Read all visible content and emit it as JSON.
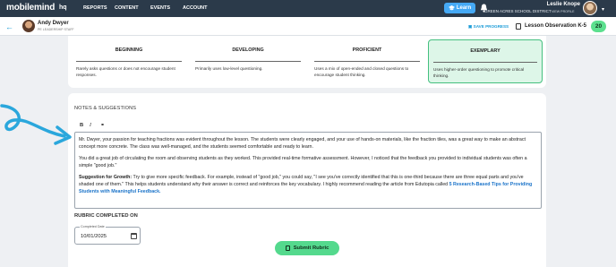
{
  "colors": {
    "nav_bg": "#2b3a4a",
    "accent_blue": "#45a9f5",
    "accent_green": "#54d98d",
    "selected_bg": "#ddf6e8",
    "arrow": "#2aa7dc"
  },
  "topnav": {
    "logo": "mobilemind",
    "logo_suffix": "hq",
    "items": [
      "REPORTS",
      "CONTENT",
      "EVENTS",
      "ACCOUNT"
    ],
    "learn_label": "Learn",
    "user_name": "Leslie Knope",
    "district": "GREEN ACRES SCHOOL DISTRICT",
    "view_profile": "VIEW PROFILE"
  },
  "subheader": {
    "staff_name": "Andy Dwyer",
    "staff_role": "PE LEADERSHIP STAFF",
    "save_progress": "SAVE PROGRESS",
    "observation_title": "Lesson Observation K-5",
    "score": "20"
  },
  "rubric": {
    "levels": [
      {
        "title": "BEGINNING",
        "desc": "Rarely asks questions or does not encourage student responses."
      },
      {
        "title": "DEVELOPING",
        "desc": "Primarily uses low-level questioning."
      },
      {
        "title": "PROFICIENT",
        "desc": "Uses a mix of open-ended and closed questions to encourage student thinking."
      },
      {
        "title": "EXEMPLARY",
        "desc": "Uses higher-order questioning to promote critical thinking."
      }
    ],
    "selected_index": 3
  },
  "notes": {
    "heading": "NOTES & SUGGESTIONS",
    "toolbar": {
      "bold": "B",
      "italic": "I",
      "link": "⚭"
    },
    "paragraph1": "Mr. Dwyer, your passion for teaching fractions was evident throughout the lesson. The students were clearly engaged, and your use of hands-on materials, like the fraction tiles, was a great way to make an abstract concept more concrete. The class was well-managed, and the students seemed comfortable and ready to learn.",
    "paragraph2": "You did a great job of circulating the room and observing students as they worked. This provided real-time formative assessment. However, I noticed that the feedback you provided to individual students was often a simple \"good job.\"",
    "paragraph3_label": "Suggestion for Growth:",
    "paragraph3_text": " Try to give more specific feedback. For example, instead of \"good job,\" you could say, \"I see you've correctly identified that this is one-third because there are three equal parts and you've shaded one of them.\" This helps students understand why their answer is correct and reinforces the key vocabulary. I highly recommend reading the article from Edutopia called ",
    "paragraph3_link": "5 Research-Based Tips for Providing Students with Meaningful Feedback."
  },
  "completed": {
    "heading": "RUBRIC COMPLETED ON",
    "date_label": "Completed Date",
    "date_value": "10/01/2025"
  },
  "submit_label": "Submit Rubric"
}
